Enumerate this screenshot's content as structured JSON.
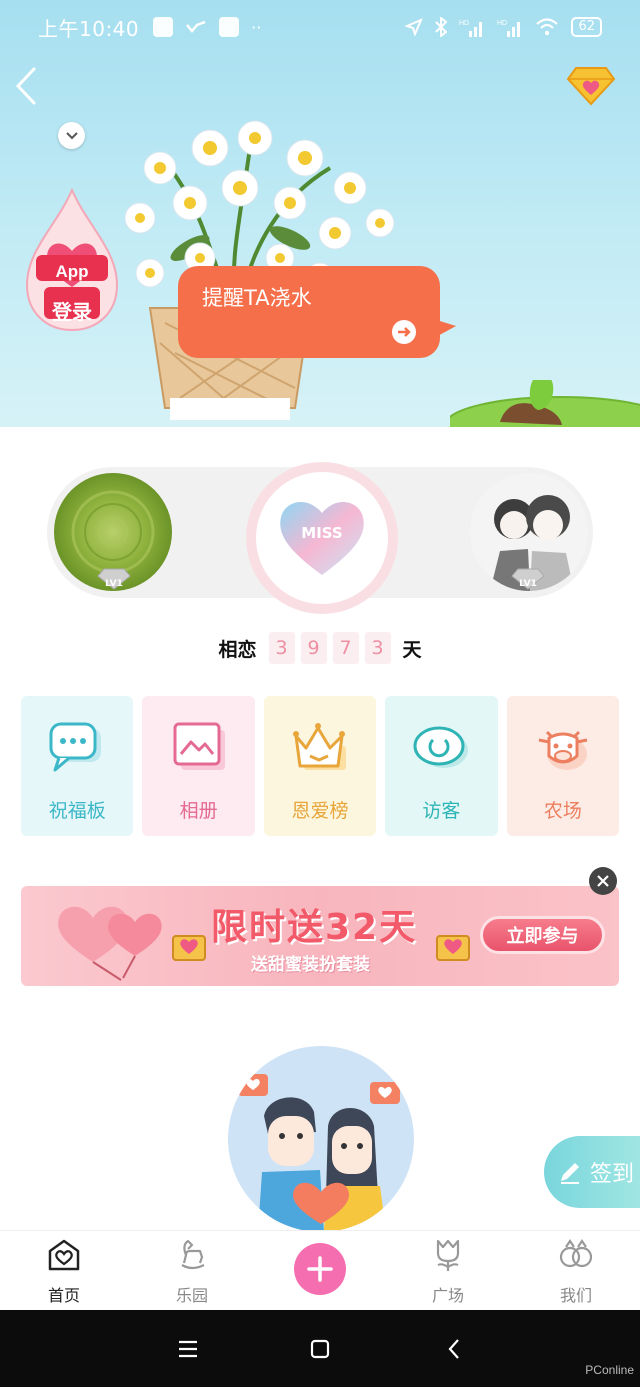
{
  "status_bar": {
    "time": "上午10:40",
    "battery": "62",
    "signal_labels": [
      "HD",
      "HD"
    ]
  },
  "hero": {
    "app_login_line1": "App",
    "app_login_line2": "登录",
    "reminder_text": "提醒TA浇水"
  },
  "couple": {
    "left_level": "LV1",
    "right_level": "LV1",
    "center_badge": "MISS",
    "days_label": "相恋",
    "days_digits": [
      "3",
      "9",
      "7",
      "3"
    ],
    "days_unit": "天"
  },
  "features": [
    {
      "label": "祝福板",
      "icon": "message-bubble-icon",
      "bg": "#e6f7fa",
      "color": "#3bb7c8"
    },
    {
      "label": "相册",
      "icon": "photo-album-icon",
      "bg": "#fdebf1",
      "color": "#e46a92"
    },
    {
      "label": "恩爱榜",
      "icon": "crown-icon",
      "bg": "#fdf6df",
      "color": "#e7a53a"
    },
    {
      "label": "访客",
      "icon": "eye-icon",
      "bg": "#e4f7f7",
      "color": "#2fb4b5"
    },
    {
      "label": "农场",
      "icon": "cow-icon",
      "bg": "#fdece6",
      "color": "#ec7f5f"
    }
  ],
  "banner": {
    "title": "限时送32天",
    "subtitle": "送甜蜜装扮套装",
    "cta": "立即参与"
  },
  "checkin": {
    "label": "签到"
  },
  "tabbar": {
    "tabs": [
      {
        "label": "首页",
        "icon": "home-heart-icon",
        "active": true
      },
      {
        "label": "乐园",
        "icon": "rocking-horse-icon",
        "active": false
      },
      {
        "label": "",
        "icon": "plus-icon",
        "active": false
      },
      {
        "label": "广场",
        "icon": "tulip-icon",
        "active": false
      },
      {
        "label": "我们",
        "icon": "rings-icon",
        "active": false
      }
    ]
  },
  "watermark": "PConline"
}
